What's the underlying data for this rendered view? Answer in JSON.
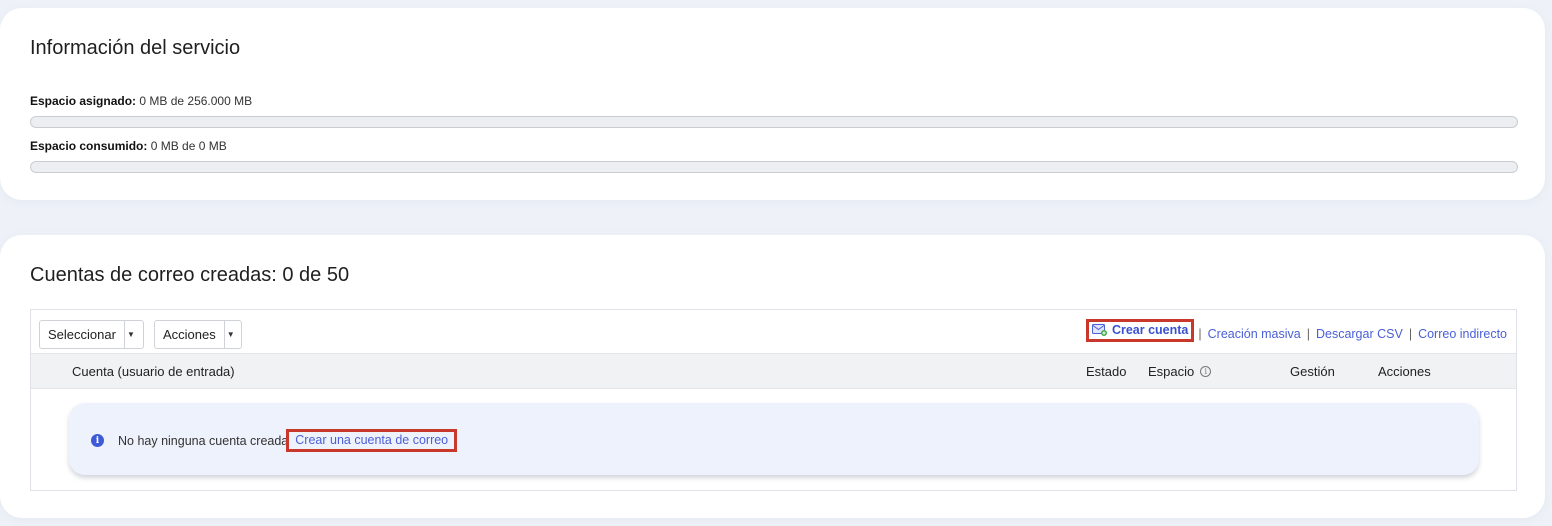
{
  "service": {
    "title": "Información del servicio",
    "assigned_label": "Espacio asignado:",
    "assigned_value": "0 MB de 256.000 MB",
    "assigned_fraction": 0,
    "consumed_label": "Espacio consumido:",
    "consumed_value": "0 MB de 0 MB",
    "consumed_fraction": 0
  },
  "accounts": {
    "title": "Cuentas de correo creadas: 0 de 50",
    "toolbar": {
      "select_label": "Seleccionar",
      "actions_label": "Acciones",
      "create_account": "Crear cuenta",
      "bulk_create": "Creación masiva",
      "download_csv": "Descargar CSV",
      "indirect_mail": "Correo indirecto",
      "separator": "|"
    },
    "columns": {
      "account": "Cuenta (usuario de entrada)",
      "state": "Estado",
      "space": "Espacio",
      "space_info_glyph": "i",
      "management": "Gestión",
      "actions": "Acciones"
    },
    "empty": {
      "info_glyph": "i",
      "message": "No hay ninguna cuenta creada",
      "link": "Crear una cuenta de correo"
    }
  },
  "colors": {
    "accent": "#4a5fd6",
    "highlight_border": "#c8392b",
    "page_bg": "#eef2f8"
  },
  "icons": [
    "mail-add-icon",
    "info-icon",
    "caret-down-icon"
  ]
}
